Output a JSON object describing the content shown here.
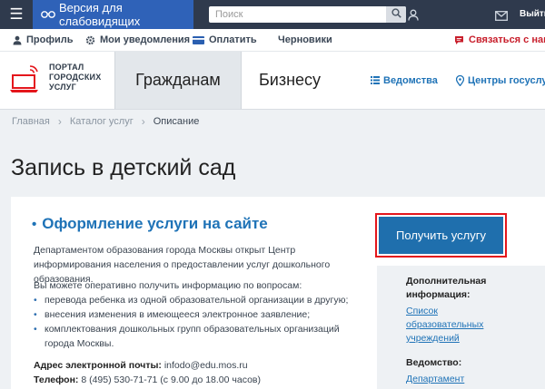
{
  "topbar": {
    "vision_label": "Версия для слабовидящих",
    "search_placeholder": "Поиск",
    "exit_label": "Выйти"
  },
  "subnav": {
    "profile": "Профиль",
    "notifications": "Мои уведомления",
    "pay": "Оплатить",
    "drafts": "Черновики",
    "contact": "Связаться с нами"
  },
  "header": {
    "logo_line1": "ПОРТАЛ",
    "logo_line2": "ГОРОДСКИХ",
    "logo_line3": "УСЛУГ",
    "tab_citizens": "Гражданам",
    "tab_business": "Бизнесу",
    "departments": "Ведомства",
    "centers": "Центры госуслуг"
  },
  "breadcrumb": {
    "items": [
      "Главная",
      "Каталог услуг",
      "Описание"
    ]
  },
  "page": {
    "title": "Запись в детский сад"
  },
  "service": {
    "heading": "Оформление услуги на сайте",
    "intro": "Департаментом образования города Москвы открыт Центр информирования населения о предоставлении услуг дошкольного образования.",
    "lead": "Вы можете оперативно получить информацию по вопросам:",
    "bullets": [
      "перевода ребенка из одной образовательной организации в другую;",
      "внесения изменения в имеющееся электронное заявление;",
      "комплектования дошкольных групп образовательных организаций города Москвы."
    ],
    "email_label": "Адрес электронной почты:",
    "email_value": "infodo@edu.mos.ru",
    "phone_label": "Телефон:",
    "phone_value": "8 (495) 530-71-71 (с 9.00 до 18.00 часов)",
    "button": "Получить услугу"
  },
  "sidebar": {
    "extra_heading": "Дополнительная информация:",
    "extra_link": "Список образовательных учреждений",
    "dept_heading": "Ведомство:",
    "dept_link": "Департамент"
  }
}
